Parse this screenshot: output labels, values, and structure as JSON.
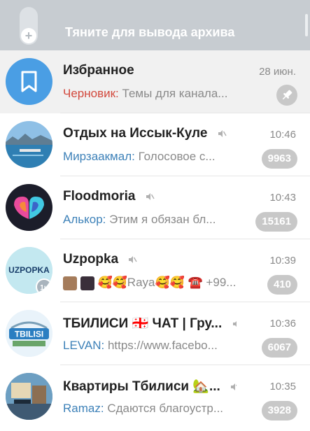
{
  "archive": {
    "text": "Тяните для вывода архива"
  },
  "chats": [
    {
      "title": "Избранное",
      "time": "28 июн.",
      "sender": "Черновик:",
      "preview": "Темы для канала...",
      "badge": "",
      "muted": false,
      "avatar_icon": "bookmark-icon",
      "avatar_color": "#4a9ee4"
    },
    {
      "title": "Отдых на Иссык-Куле",
      "time": "10:46",
      "sender": "Мирзаакмал:",
      "preview": "Голосовое с...",
      "badge": "9963",
      "muted": true,
      "avatar_icon": "lake-photo",
      "avatar_color": "#6aa1c9"
    },
    {
      "title": "Floodmoria",
      "time": "10:43",
      "sender": "Алькор:",
      "preview": "Этим я обязан бл...",
      "badge": "15161",
      "muted": true,
      "avatar_icon": "heart-hands-logo",
      "avatar_color": "#1c1d2a"
    },
    {
      "title": "Uzpopka",
      "time": "10:39",
      "sender": "",
      "preview": "🥰🥰Raya🥰🥰 ☎️ +99...",
      "badge": "410",
      "muted": true,
      "avatar_icon": "uzpopka-logo",
      "avatar_color": "#bfe6ee"
    },
    {
      "title": "ТБИЛИСИ 🇬🇪 ЧАТ | Гру...",
      "time": "10:36",
      "sender": "LEVAN:",
      "preview": "https://www.facebo...",
      "badge": "6067",
      "muted": true,
      "avatar_icon": "tbilisi-logo",
      "avatar_color": "#2b7ec1"
    },
    {
      "title": "Квартиры Тбилиси 🏡...",
      "time": "10:35",
      "sender": "Ramaz:",
      "preview": "Сдаются благоустр...",
      "badge": "3928",
      "muted": true,
      "avatar_icon": "apartment-photo",
      "avatar_color": "#5c8fb4"
    }
  ],
  "uzpopka_avatar_text": "UZPOPKA",
  "tbilisi_avatar_text": "TBILISI",
  "avatar_timer": "1н"
}
